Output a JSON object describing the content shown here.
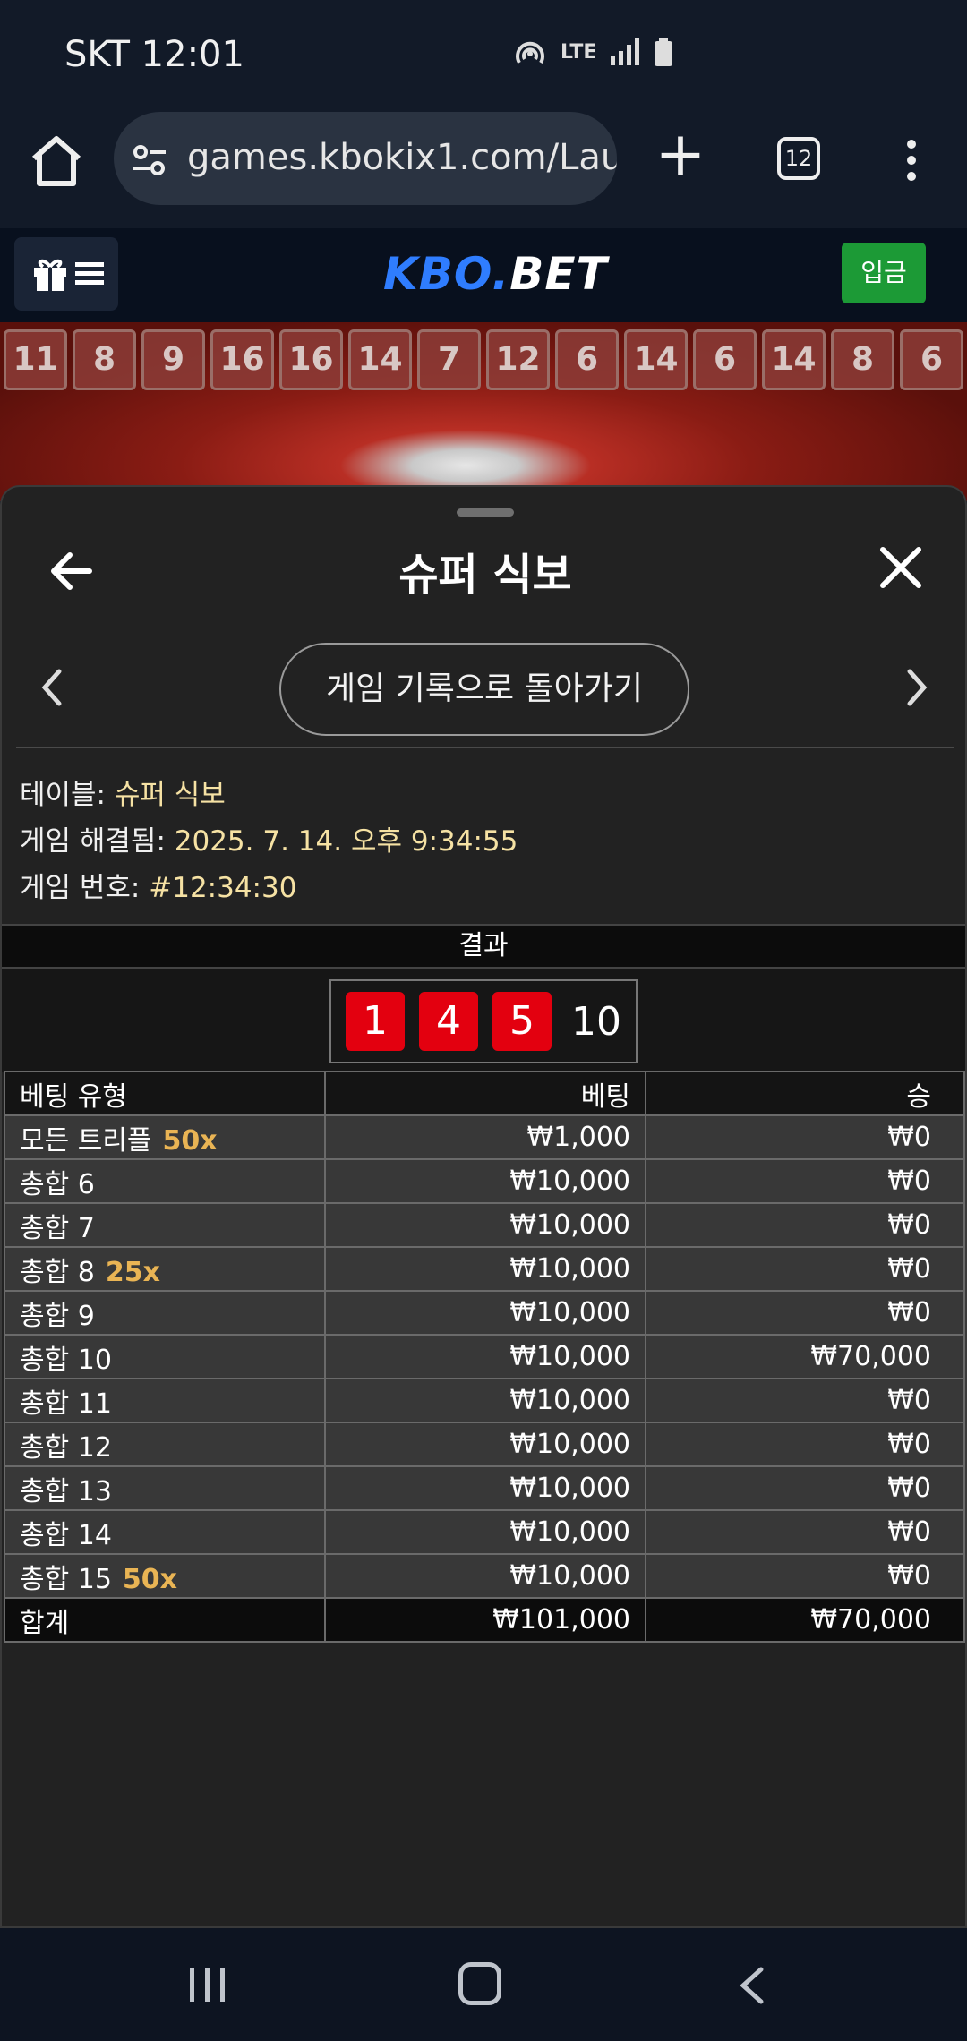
{
  "status_bar": {
    "carrier_time": "SKT 12:01",
    "network": "LTE"
  },
  "browser": {
    "url": "games.kbokix1.com/Laun",
    "tab_count": "12"
  },
  "site": {
    "logo_kbo": "KBO",
    "logo_dot": ".",
    "logo_bet": "BET",
    "deposit_label": "입금"
  },
  "history_strip": [
    "11",
    "8",
    "9",
    "16",
    "16",
    "14",
    "7",
    "12",
    "6",
    "14",
    "6",
    "14",
    "8",
    "6"
  ],
  "panel": {
    "title": "슈퍼 식보",
    "back_to_history_label": "게임 기록으로 돌아가기",
    "table_label": "테이블:",
    "table_value": "슈퍼 식보",
    "resolved_label": "게임 해결됨:",
    "resolved_value": "2025. 7. 14. 오후 9:34:55",
    "game_no_label": "게임 번호:",
    "game_no_value": "#12:34:30",
    "results_header": "결과",
    "dice": [
      "1",
      "4",
      "5"
    ],
    "dice_total": "10"
  },
  "bets_table": {
    "headers": [
      "베팅 유형",
      "베팅",
      "승"
    ],
    "rows": [
      {
        "type": "모든 트리플",
        "mult": "50x",
        "bet": "₩1,000",
        "win": "₩0"
      },
      {
        "type": "총합 6",
        "mult": "",
        "bet": "₩10,000",
        "win": "₩0"
      },
      {
        "type": "총합 7",
        "mult": "",
        "bet": "₩10,000",
        "win": "₩0"
      },
      {
        "type": "총합 8",
        "mult": "25x",
        "bet": "₩10,000",
        "win": "₩0"
      },
      {
        "type": "총합 9",
        "mult": "",
        "bet": "₩10,000",
        "win": "₩0"
      },
      {
        "type": "총합 10",
        "mult": "",
        "bet": "₩10,000",
        "win": "₩70,000"
      },
      {
        "type": "총합 11",
        "mult": "",
        "bet": "₩10,000",
        "win": "₩0"
      },
      {
        "type": "총합 12",
        "mult": "",
        "bet": "₩10,000",
        "win": "₩0"
      },
      {
        "type": "총합 13",
        "mult": "",
        "bet": "₩10,000",
        "win": "₩0"
      },
      {
        "type": "총합 14",
        "mult": "",
        "bet": "₩10,000",
        "win": "₩0"
      },
      {
        "type": "총합 15",
        "mult": "50x",
        "bet": "₩10,000",
        "win": "₩0"
      }
    ],
    "total": {
      "label": "합계",
      "bet": "₩101,000",
      "win": "₩70,000"
    }
  },
  "colors": {
    "accent_blue": "#2f7dff",
    "deposit_green": "#1c9a36",
    "die_red": "#e3000f",
    "multiplier_gold": "#e9b454",
    "info_value": "#f6e2a4"
  },
  "icons": {
    "home": "home-icon",
    "site_settings": "tune-icon",
    "gift": "gift-icon",
    "hamburger": "hamburger-icon",
    "back": "arrow-left-icon",
    "close": "close-icon",
    "prev": "chevron-left-icon",
    "next": "chevron-right-icon"
  }
}
